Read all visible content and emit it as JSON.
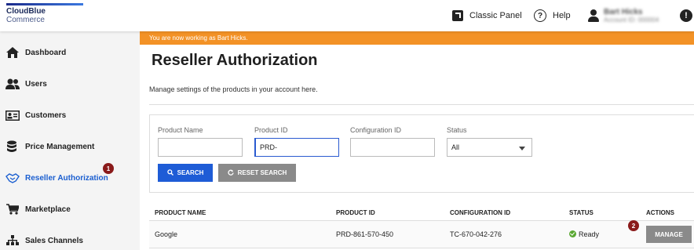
{
  "brand": {
    "line1": "CloudBlue",
    "line2": "Commerce"
  },
  "topbar": {
    "classic_panel": "Classic Panel",
    "help": "Help",
    "user_name": "Bart Hicks",
    "user_account": "Account ID: 000004"
  },
  "sidebar": {
    "items": [
      {
        "label": "Dashboard",
        "icon": "home-icon"
      },
      {
        "label": "Users",
        "icon": "users-icon"
      },
      {
        "label": "Customers",
        "icon": "id-card-icon"
      },
      {
        "label": "Price Management",
        "icon": "coins-icon"
      },
      {
        "label": "Reseller Authorization",
        "icon": "handshake-icon",
        "active": true,
        "badge": "1"
      },
      {
        "label": "Marketplace",
        "icon": "cart-icon"
      },
      {
        "label": "Sales Channels",
        "icon": "sitemap-icon"
      }
    ]
  },
  "banner": {
    "text": "You are now working as Bart Hicks."
  },
  "page": {
    "title": "Reseller Authorization",
    "subtitle": "Manage settings of the products in your account here."
  },
  "filters": {
    "product_name_label": "Product Name",
    "product_name_value": "",
    "product_id_label": "Product ID",
    "product_id_value": "PRD-",
    "configuration_id_label": "Configuration ID",
    "configuration_id_value": "",
    "status_label": "Status",
    "status_value": "All",
    "search_label": "SEARCH",
    "reset_label": "RESET SEARCH"
  },
  "table": {
    "headers": [
      "PRODUCT NAME",
      "PRODUCT ID",
      "CONFIGURATION ID",
      "STATUS",
      "ACTIONS"
    ],
    "rows": [
      {
        "product_name": "Google",
        "product_id": "PRD-861-570-450",
        "configuration_id": "TC-670-042-276",
        "status": "Ready",
        "action": "MANAGE",
        "badge": "2"
      }
    ]
  },
  "colors": {
    "accent": "#1e5cd6",
    "banner": "#f39226",
    "badge": "#8a1a1a",
    "ready": "#5aa832"
  }
}
